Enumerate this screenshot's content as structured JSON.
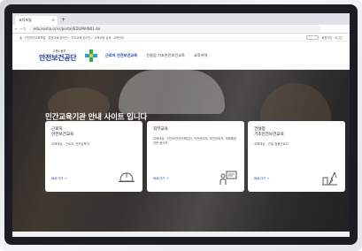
{
  "browser": {
    "tab_label": "교육포털",
    "tab_close": "×",
    "new_tab": "+",
    "nav_buttons": "← → ↻",
    "url": "edu.kosha.or.kr/portal/EDUMAIN01.do"
  },
  "utility": {
    "left": "홈 · 안전보건교육포털 · 법정교육(온라인) · 직무교육(온라인) · 교육과정 검색 · 교육안내",
    "right": "회원가입 · 로그인"
  },
  "header": {
    "logo_sub": "고용노동부",
    "logo_main": "안전보건공단",
    "menu": [
      "근로자 안전보건교육",
      "건설업 기초안전보건교육",
      "교육이력"
    ]
  },
  "hero": {
    "title": "민간교육기관 안내 사이트 입니다"
  },
  "cards": [
    {
      "title": "근로자\n안전보건교육",
      "desc": "교육대상 : 근로자, 관리감독자",
      "link": "바로가기 →",
      "icon": "hardhat-icon"
    },
    {
      "title": "직무교육",
      "desc": "교육대상 : 안전보건관리책임자, 안전관리자, 보건관리자, 재해예방전문 종사자",
      "link": "바로가기 →",
      "icon": "presentation-icon"
    },
    {
      "title": "건설업\n기초안전보건교육",
      "desc": "교육대상 : 건설 일용근로자",
      "link": "바로가기 →",
      "icon": "construction-icon"
    }
  ]
}
